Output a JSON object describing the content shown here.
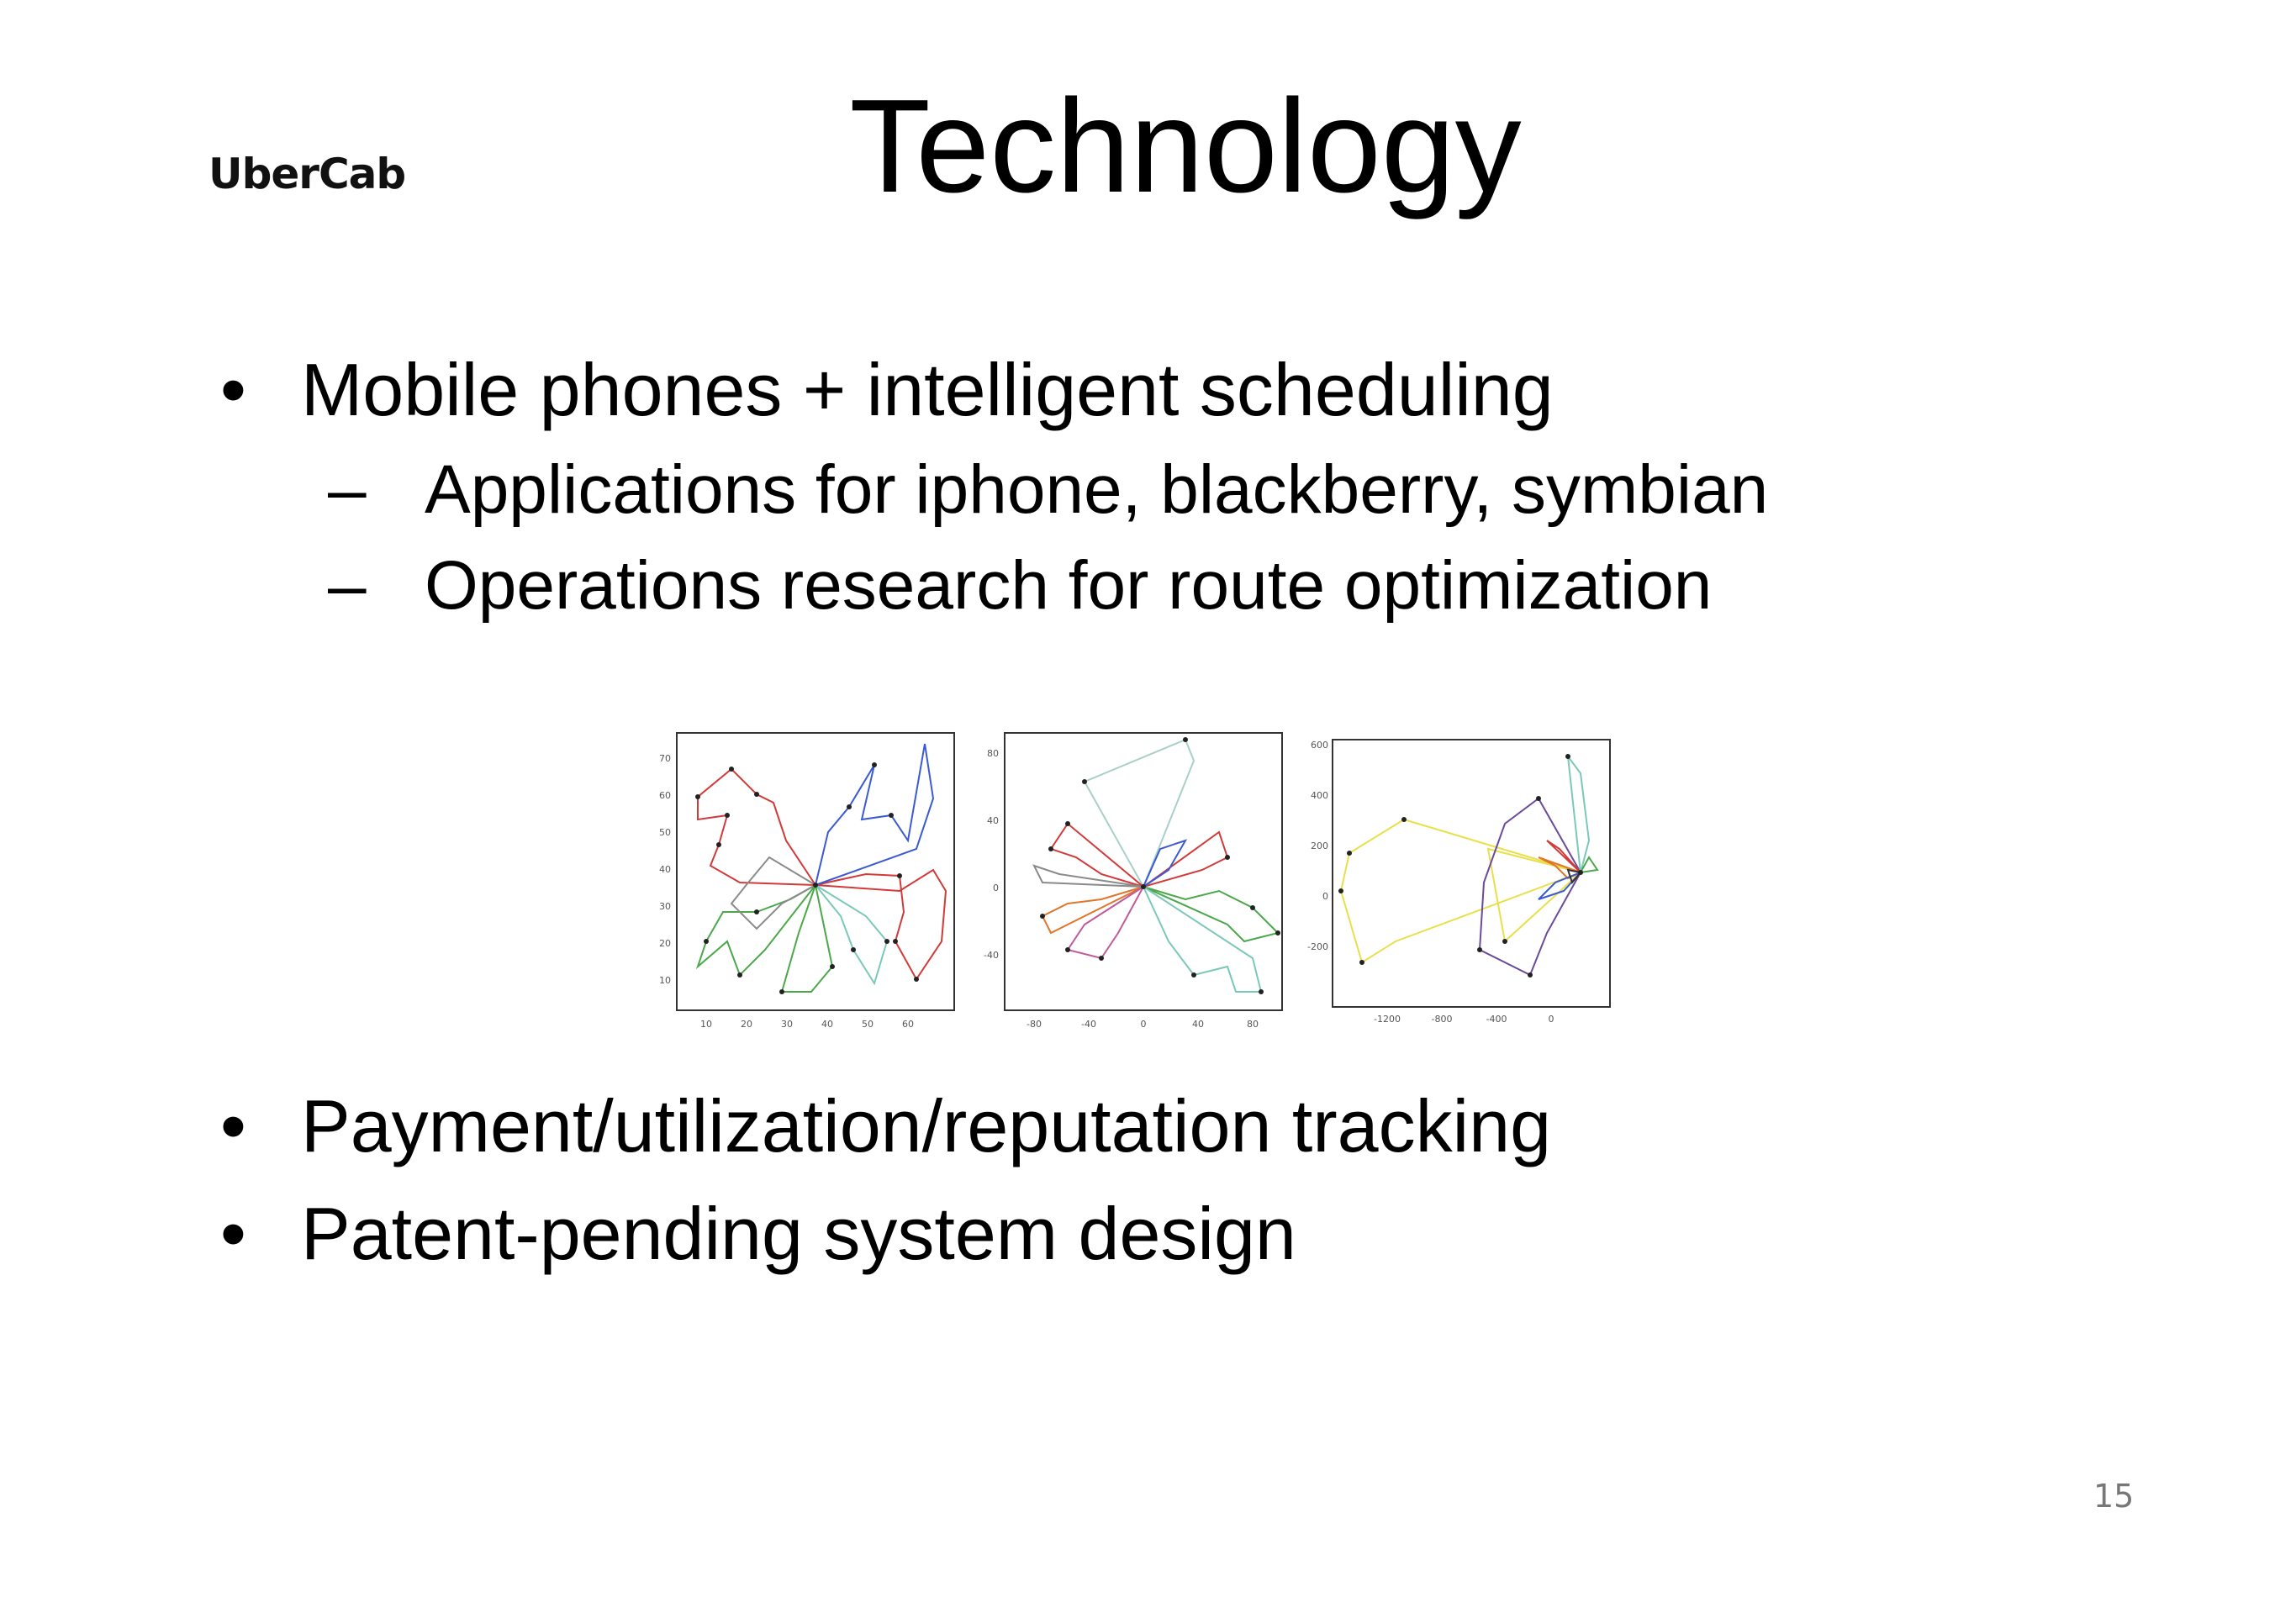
{
  "slide": {
    "logo": "UberCab",
    "title": "Technology",
    "bullets": [
      {
        "text": "Mobile phones + intelligent scheduling"
      },
      {
        "text": "Payment/utilization/reputation tracking"
      },
      {
        "text": "Patent-pending system design"
      }
    ],
    "sub_bullets": [
      {
        "text": "Applications for iphone, blackberry, symbian"
      },
      {
        "text": "Operations research for route optimization"
      }
    ],
    "page_number": "15"
  },
  "plots": [
    {
      "x_ticks": [
        "10",
        "20",
        "30",
        "40",
        "50",
        "60"
      ],
      "y_ticks": [
        "70",
        "60",
        "50",
        "40",
        "30",
        "20",
        "10"
      ]
    },
    {
      "x_ticks": [
        "-80",
        "-40",
        "0",
        "40",
        "80"
      ],
      "y_ticks": [
        "80",
        "40",
        "0",
        "-40"
      ]
    },
    {
      "x_ticks": [
        "-1200",
        "-800",
        "-400",
        "0"
      ],
      "y_ticks": [
        "600",
        "400",
        "200",
        "0",
        "-200"
      ]
    }
  ]
}
